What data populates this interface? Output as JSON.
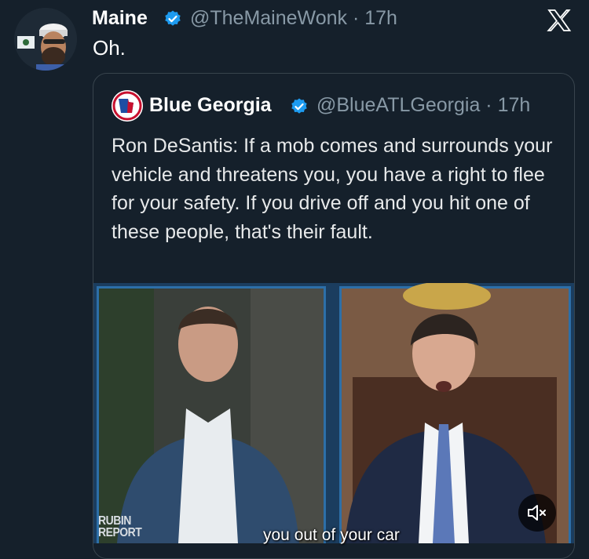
{
  "tweet": {
    "author_name": "Maine",
    "handle_time": "@TheMaineWonk · 17h",
    "text": "Oh."
  },
  "quoted": {
    "author_name": "Blue Georgia",
    "handle_time": "@BlueATLGeorgia · 17h",
    "text": "Ron DeSantis: If a mob comes and surrounds your vehicle and threatens you, you have a right to flee for your safety. If you drive off and you hit one of these people, that's their fault."
  },
  "video": {
    "caption": "you out of your car",
    "watermark": "RUBIN REPORT"
  },
  "icons": {
    "verified": "verified-badge-icon",
    "brand": "x-logo-icon",
    "mute": "muted-speaker-icon"
  },
  "colors": {
    "background": "#15202b",
    "verified_blue": "#1d9bf0",
    "secondary_text": "#8899a6",
    "video_border": "#2d6fa8"
  }
}
